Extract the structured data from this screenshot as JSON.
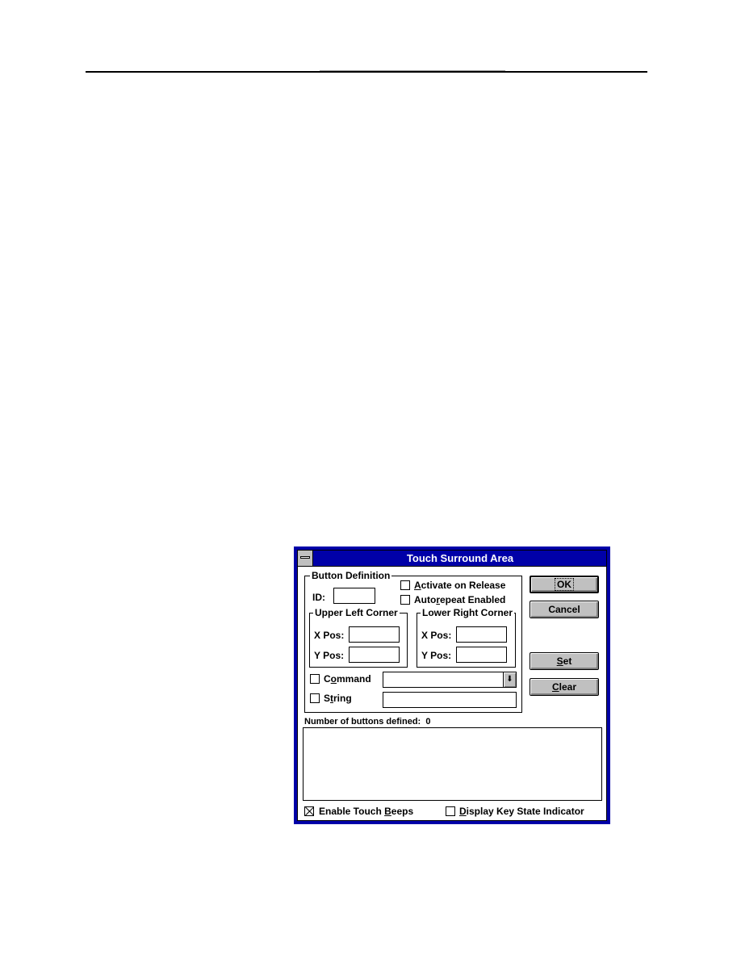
{
  "dialog": {
    "title": "Touch Surround Area",
    "button_definition": {
      "group_label": "Button Definition",
      "id_label": "ID:",
      "id_value": "",
      "activate_on_release": {
        "pre": "",
        "u": "A",
        "post": "ctivate on Release",
        "checked": false
      },
      "autorepeat_enabled": {
        "pre": "Auto",
        "u": "r",
        "post": "epeat Enabled",
        "checked": false
      },
      "upper_left": {
        "label": "Upper Left Corner",
        "x_label": "X Pos:",
        "y_label": "Y Pos:",
        "x_value": "",
        "y_value": ""
      },
      "lower_right": {
        "label": "Lower Right Corner",
        "x_label": "X Pos:",
        "y_label": "Y Pos:",
        "x_value": "",
        "y_value": ""
      },
      "command": {
        "pre": "C",
        "u": "o",
        "post": "mmand",
        "checked": false,
        "value": ""
      },
      "string": {
        "pre": "S",
        "u": "t",
        "post": "ring",
        "checked": false,
        "value": ""
      }
    },
    "buttons": {
      "ok": "OK",
      "cancel": "Cancel",
      "set": {
        "u": "S",
        "post": "et"
      },
      "clear": {
        "u": "C",
        "post": "lear"
      }
    },
    "count_label": "Number of buttons defined:",
    "count_value": "0",
    "enable_touch_beeps": {
      "pre": "Enable Touch ",
      "u": "B",
      "post": "eeps",
      "checked": true
    },
    "display_key_state": {
      "pre": "",
      "u": "D",
      "post": "isplay Key State Indicator",
      "checked": false
    }
  }
}
